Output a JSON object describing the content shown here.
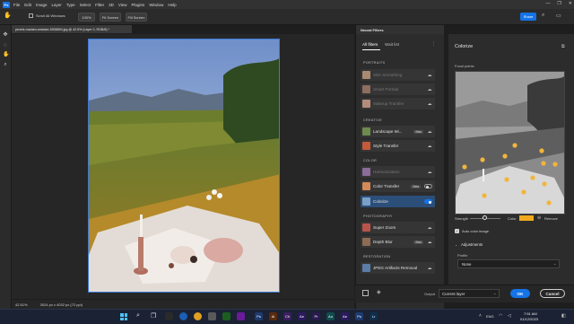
{
  "app": {
    "logo_label": "Ps",
    "accent": "#1473e6"
  },
  "menu": [
    "File",
    "Edit",
    "Image",
    "Layer",
    "Type",
    "Select",
    "Filter",
    "3D",
    "View",
    "Plugins",
    "Window",
    "Help"
  ],
  "window_controls": [
    "—",
    "❐",
    "✕"
  ],
  "options_bar": {
    "scroll_all_windows": "Scroll All Windows",
    "zoom_value": "100%",
    "fit_screen": "Fit Screen",
    "fill_screen": "Fill Screen",
    "share": "Share"
  },
  "tools": [
    "move-icon",
    "marquee-icon",
    "hand-icon",
    "zoom-icon"
  ],
  "document": {
    "tab_title": "pexels-mariam-antadze-5908894.jpg @ 42.5% (Layer 0, RGB/8) *",
    "zoom": "42.51%",
    "dimensions": "3024 px x 4032 px (72 ppi)"
  },
  "neural_filters": {
    "panel_title": "Neural Filters",
    "tabs": {
      "all": "All filters",
      "wait": "Wait list"
    },
    "categories": {
      "portraits": "PORTRAITS",
      "creative": "CREATIVE",
      "color": "COLOR",
      "photography": "PHOTOGRAPHY",
      "restoration": "RESTORATION"
    },
    "filters": [
      {
        "label": "Skin Smoothing",
        "state": "cloud",
        "thumb": "#a88a73"
      },
      {
        "label": "Smart Portrait",
        "state": "cloud",
        "thumb": "#8e6e5f"
      },
      {
        "label": "Makeup Transfer",
        "state": "cloud",
        "thumb": "#b58c7c"
      },
      {
        "label": "Landscape Mi...",
        "state": "beta",
        "beta": "Beta",
        "thumb": "#6f8a4e"
      },
      {
        "label": "Style Transfer",
        "state": "cloud",
        "thumb": "#c45a3b"
      },
      {
        "label": "Harmonization",
        "state": "cloud",
        "thumb": "#8b6c9a"
      },
      {
        "label": "Color Transfer",
        "state": "beta-toggle",
        "beta": "Beta",
        "thumb": "#d4895a"
      },
      {
        "label": "Colorize",
        "state": "toggle-on",
        "thumb": "#7aa0c8"
      },
      {
        "label": "Super Zoom",
        "state": "cloud",
        "thumb": "#b9544b"
      },
      {
        "label": "Depth Blur",
        "state": "beta",
        "beta": "Beta",
        "thumb": "#8c6c54"
      },
      {
        "label": "JPEG Artifacts Removal",
        "state": "cloud",
        "thumb": "#5b7da8"
      }
    ],
    "output_label": "Output",
    "output_value": "Current layer",
    "ok": "OK",
    "cancel": "Cancel"
  },
  "colorize": {
    "title": "Colorize",
    "focal_points": "Focal points",
    "strength": "Strength",
    "color": "Color",
    "remove": "Remove",
    "auto_color": "Auto color image",
    "adjustments": "Adjustments",
    "profile_label": "Profile",
    "profile_value": "None",
    "swatch": "#f2a81d"
  },
  "taskbar": {
    "lang": "ENG",
    "time": "7:51 AM",
    "date": "01/12/2023",
    "apps": [
      {
        "label": "Ps",
        "color": "#1d3a6e"
      },
      {
        "label": "Ai",
        "color": "#5a2a0f"
      },
      {
        "label": "Ch",
        "color": "#3a1f5e"
      },
      {
        "label": "Ae",
        "color": "#2b1a5e"
      },
      {
        "label": "Pr",
        "color": "#2a1a4f"
      },
      {
        "label": "Au",
        "color": "#0f4d4d"
      },
      {
        "label": "Ae",
        "color": "#2b1a5e"
      },
      {
        "label": "Ps",
        "color": "#1d3a6e"
      },
      {
        "label": "Lr",
        "color": "#0f2e4d"
      }
    ]
  }
}
